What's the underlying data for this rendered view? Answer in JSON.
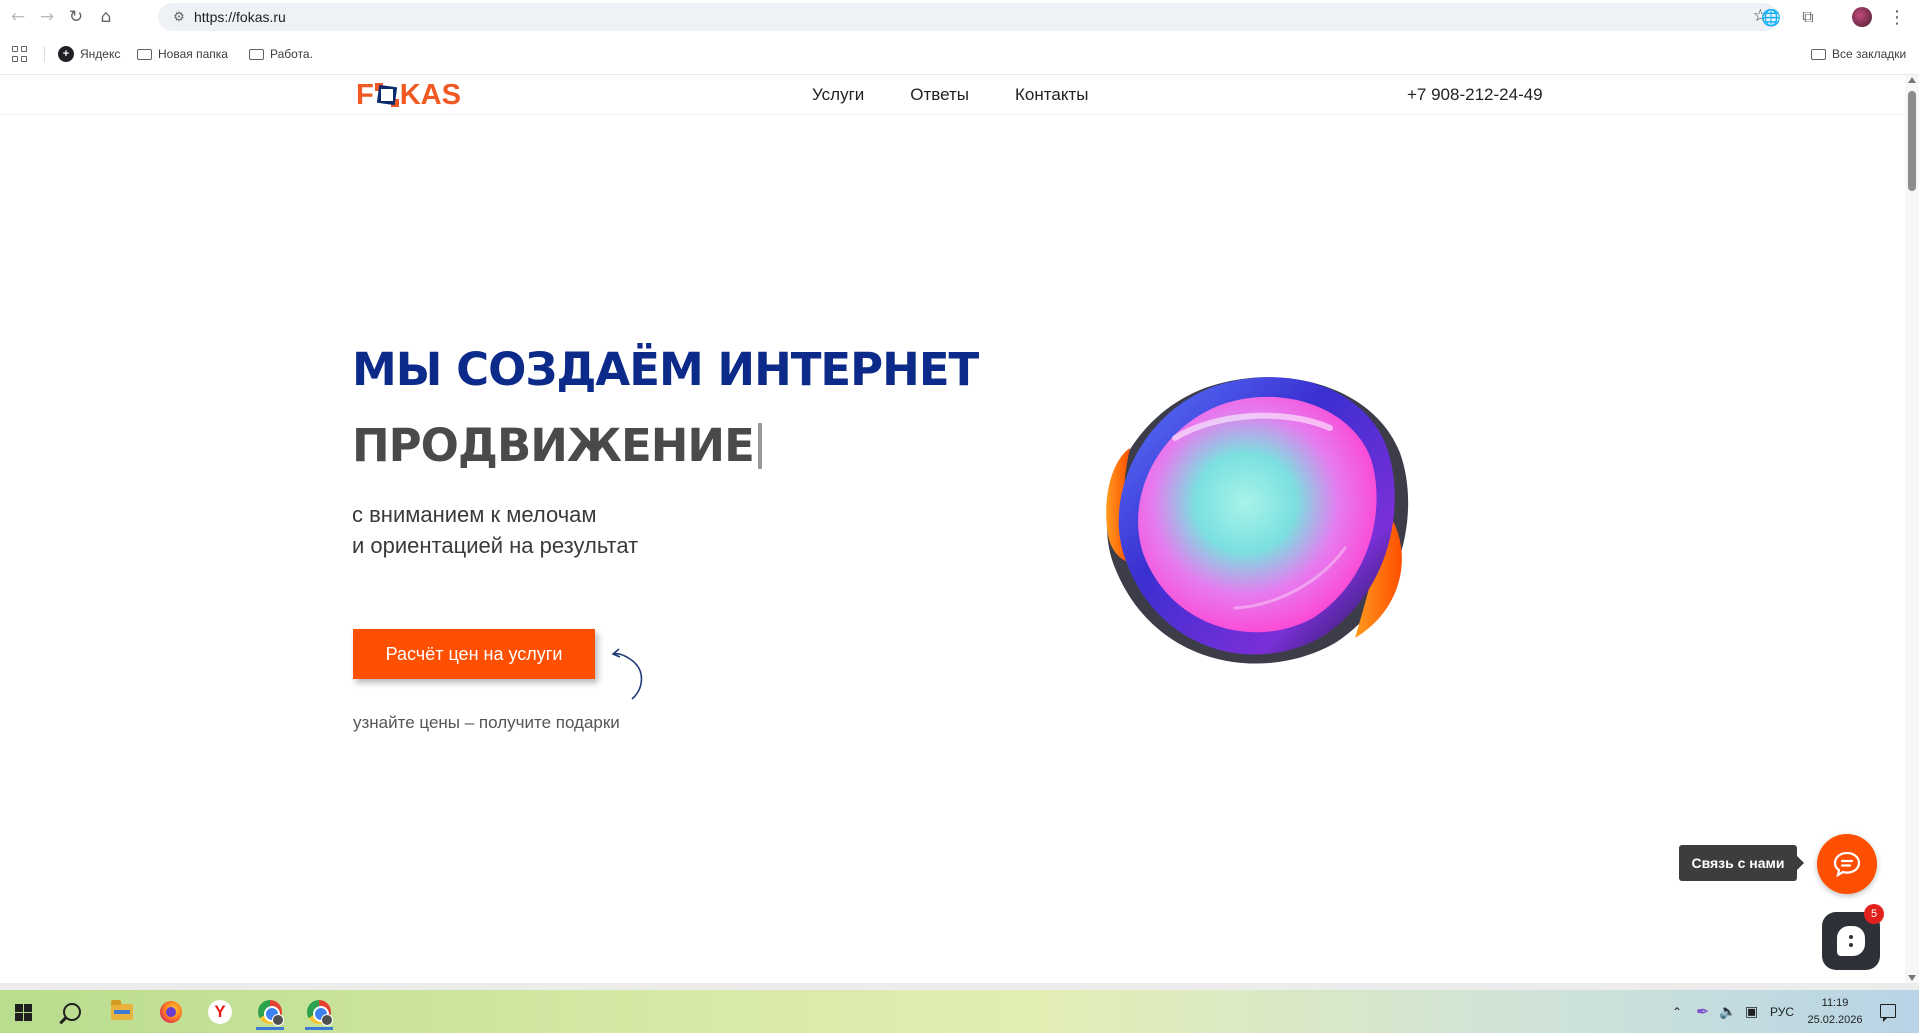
{
  "browser": {
    "url": "https://fokas.ru",
    "icons": {
      "back": "arrow-left-icon",
      "forward": "arrow-right-icon",
      "reload": "reload-icon",
      "home": "home-icon",
      "site_settings": "tune-icon",
      "bookmark_star": "star-icon",
      "translate": "globe-icon",
      "extensions": "puzzle-icon",
      "menu": "more-vert-icon"
    }
  },
  "bookmarks": {
    "items": [
      {
        "label": "Яндекс",
        "icon": "yandex-icon"
      },
      {
        "label": "Новая папка",
        "icon": "folder-icon"
      },
      {
        "label": "Работа.",
        "icon": "folder-icon"
      }
    ],
    "all_bookmarks": "Все закладки"
  },
  "site": {
    "logo_left": "F",
    "logo_right": "KAS",
    "nav": [
      "Услуги",
      "Ответы",
      "Контакты"
    ],
    "phone": "+7 908-212-24-49",
    "hero": {
      "title_line1": "МЫ СОЗДАЁМ ИНТЕРНЕТ",
      "title_line2": "ПРОДВИЖЕНИЕ",
      "subtitle_line1": "с вниманием к мелочам",
      "subtitle_line2": "и ориентацией на результат",
      "cta_label": "Расчёт цен на услуги",
      "cta_note": "узнайте цены – получите подарки"
    },
    "chat": {
      "label": "Связь с нами",
      "bot_badge": "5"
    },
    "colors": {
      "accent_orange": "#ff4f00",
      "title_blue": "#0b2a8a",
      "title_gray": "#4a4a4a"
    }
  },
  "taskbar": {
    "language": "РУС",
    "time": "11:19",
    "date": "25.02.2026",
    "apps": [
      "start-icon",
      "search-icon",
      "file-explorer-icon",
      "firefox-icon",
      "yandex-browser-icon",
      "chrome-icon",
      "chrome-profile-icon"
    ]
  }
}
